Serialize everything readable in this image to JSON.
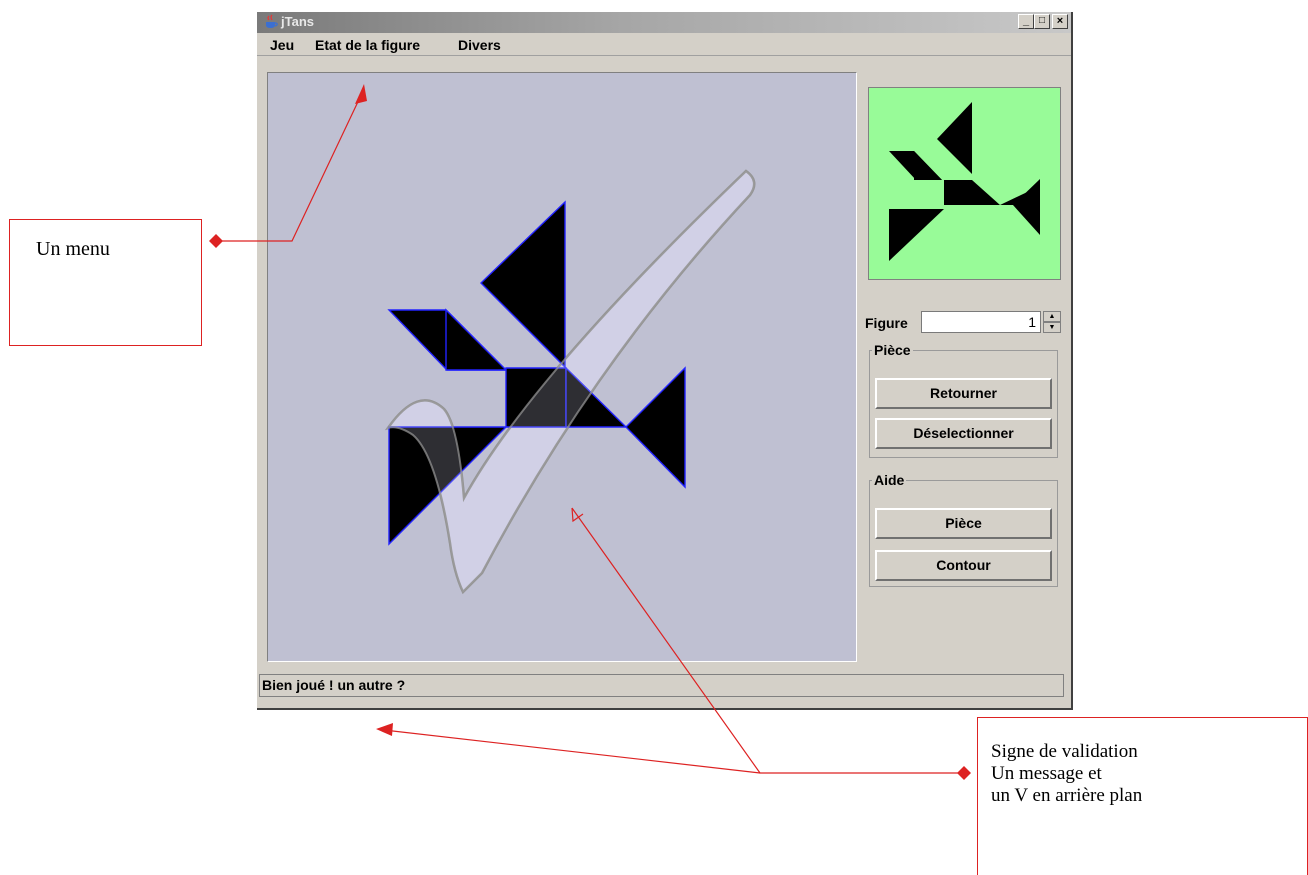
{
  "window": {
    "title": "jTans",
    "controls": [
      "_",
      "□",
      "×"
    ]
  },
  "menubar": {
    "items": [
      "Jeu",
      "Etat de la figure",
      "Divers"
    ]
  },
  "side_panel": {
    "figure_label": "Figure",
    "figure_value": "1",
    "spinner_up": "▲",
    "spinner_down": "▼",
    "piece_group": {
      "title": "Pièce",
      "buttons": [
        "Retourner",
        "Déselectionner"
      ]
    },
    "aide_group": {
      "title": "Aide",
      "buttons": [
        "Pièce",
        "Contour"
      ]
    },
    "preview_color": "#98fb98"
  },
  "status_bar": {
    "message": "Bien joué ! un autre ?"
  },
  "colors": {
    "board_bg": "#bfc0d2",
    "piece_fill": "#000000",
    "piece_edge": "#2222ff",
    "annotation_red": "#dd2222"
  },
  "annotations": {
    "menu_box": "Un menu",
    "validation_box": [
      "Signe de validation",
      "Un message et",
      "un V en arrière plan"
    ]
  }
}
